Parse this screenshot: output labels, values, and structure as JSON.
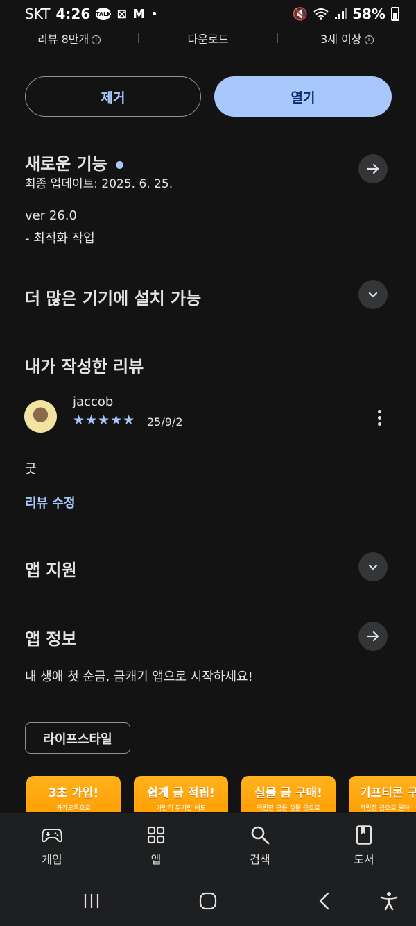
{
  "status_bar": {
    "carrier": "SKT",
    "time": "4:26",
    "talk_badge": "TALK",
    "battery": "58%"
  },
  "stats": {
    "reviews": "리뷰 8만개",
    "downloads": "다운로드",
    "age": "3세 이상"
  },
  "actions": {
    "uninstall": "제거",
    "open": "열기"
  },
  "whats_new": {
    "title": "새로운 기능",
    "updated": "최종 업데이트: 2025. 6. 25.",
    "version": "ver 26.0",
    "notes": "- 최적화 작업"
  },
  "more_devices": {
    "title": "더 많은 기기에 설치 가능"
  },
  "my_review": {
    "title": "내가 작성한 리뷰",
    "user": "jaccob",
    "rating": 5,
    "stars": "★★★★★",
    "date": "25/9/2",
    "text": "굿",
    "edit_label": "리뷰 수정"
  },
  "app_support": {
    "title": "앱 지원"
  },
  "app_info": {
    "title": "앱 정보",
    "description": "내 생애 첫 순금, 금캐기 앱으로 시작하세요!",
    "category": "라이프스타일"
  },
  "screenshots": [
    {
      "title": "3초 가입!",
      "subtitle": "카카오톡으로"
    },
    {
      "title": "쉽게 금 적립!",
      "subtitle": "가만히 두기만 해도"
    },
    {
      "title": "실물 금 구매!",
      "subtitle": "적립한 금을 실물 금으로"
    },
    {
      "title": "기프티콘 구",
      "subtitle": "적립한 금으로 원하"
    }
  ],
  "bottom_nav": [
    {
      "label": "게임",
      "icon": "gamepad-icon"
    },
    {
      "label": "앱",
      "icon": "apps-grid-icon"
    },
    {
      "label": "검색",
      "icon": "search-icon"
    },
    {
      "label": "도서",
      "icon": "book-icon"
    }
  ],
  "colors": {
    "background": "#131314",
    "accent": "#a8c7fa",
    "promo_orange": "#ffa10a"
  }
}
